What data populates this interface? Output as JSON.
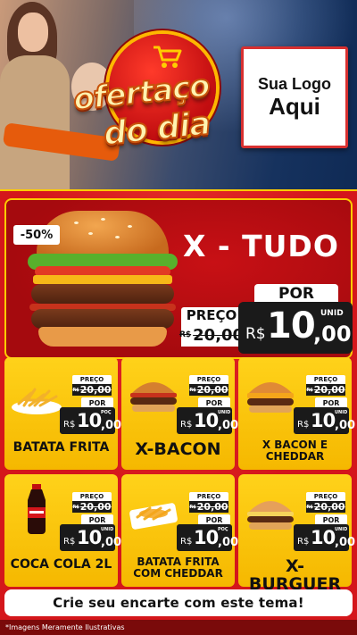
{
  "header": {
    "badge_line1": "ofertaço",
    "badge_line2": "do dia",
    "logo_line1": "Sua Logo",
    "logo_line2": "Aqui"
  },
  "hero": {
    "discount": "-50%",
    "product": "X - TUDO",
    "preco_label": "PREÇO",
    "old_currency": "R$",
    "old_price": "20,00",
    "por_label": "POR",
    "currency": "R$",
    "price_int": "10",
    "price_dec": ",00",
    "unit": "UNID"
  },
  "products": [
    {
      "name": "BATATA FRITA",
      "preco_label": "PREÇO",
      "old_currency": "R$",
      "old_price": "20,00",
      "por_label": "POR",
      "currency": "R$",
      "price_int": "10",
      "price_dec": ",00",
      "unit": "POÇ",
      "icon": "fries-icon"
    },
    {
      "name": "X-BACON",
      "preco_label": "PREÇO",
      "old_currency": "R$",
      "old_price": "20,00",
      "por_label": "POR",
      "currency": "R$",
      "price_int": "10",
      "price_dec": ",00",
      "unit": "UNID",
      "icon": "burger-icon"
    },
    {
      "name": "X BACON E CHEDDAR",
      "preco_label": "PREÇO",
      "old_currency": "R$",
      "old_price": "20,00",
      "por_label": "POR",
      "currency": "R$",
      "price_int": "10",
      "price_dec": ",00",
      "unit": "UNID",
      "icon": "burger-icon"
    },
    {
      "name": "COCA COLA 2L",
      "preco_label": "PREÇO",
      "old_currency": "R$",
      "old_price": "20,00",
      "por_label": "POR",
      "currency": "R$",
      "price_int": "10",
      "price_dec": ",00",
      "unit": "UNID",
      "icon": "soda-bottle-icon"
    },
    {
      "name": "BATATA FRITA COM CHEDDAR",
      "preco_label": "PREÇO",
      "old_currency": "R$",
      "old_price": "20,00",
      "por_label": "POR",
      "currency": "R$",
      "price_int": "10",
      "price_dec": ",00",
      "unit": "POÇ",
      "icon": "cheddar-fries-icon"
    },
    {
      "name": "X-BURGUER",
      "preco_label": "PREÇO",
      "old_currency": "R$",
      "old_price": "20,00",
      "por_label": "POR",
      "currency": "R$",
      "price_int": "10",
      "price_dec": ",00",
      "unit": "UNID",
      "icon": "burger-icon"
    }
  ],
  "cta": "Crie seu encarte com este tema!",
  "footer": "*Imagens Meramente Ilustrativas",
  "colors": {
    "red": "#d4161b",
    "yellow": "#ffd21a",
    "dark": "#1a1a1a",
    "navy": "#0f2a55"
  }
}
